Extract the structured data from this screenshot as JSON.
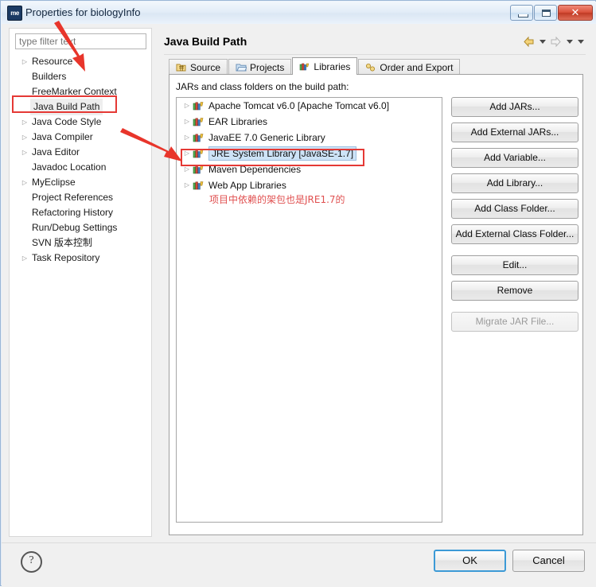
{
  "window": {
    "title": "Properties for biologyInfo",
    "icon": "myeclipse-icon",
    "icon_text": "me",
    "controls": {
      "minimize": "minimize-button",
      "maximize": "maximize-button",
      "close": "close-button",
      "close_glyph": "✕"
    }
  },
  "sidebar": {
    "filter_placeholder": "type filter text",
    "filter_value": "",
    "items": [
      {
        "label": "Resource",
        "expandable": true,
        "selected": false
      },
      {
        "label": "Builders",
        "expandable": false,
        "selected": false
      },
      {
        "label": "FreeMarker Context",
        "expandable": false,
        "selected": false
      },
      {
        "label": "Java Build Path",
        "expandable": false,
        "selected": true
      },
      {
        "label": "Java Code Style",
        "expandable": true,
        "selected": false
      },
      {
        "label": "Java Compiler",
        "expandable": true,
        "selected": false
      },
      {
        "label": "Java Editor",
        "expandable": true,
        "selected": false
      },
      {
        "label": "Javadoc Location",
        "expandable": false,
        "selected": false
      },
      {
        "label": "MyEclipse",
        "expandable": true,
        "selected": false
      },
      {
        "label": "Project References",
        "expandable": false,
        "selected": false
      },
      {
        "label": "Refactoring History",
        "expandable": false,
        "selected": false
      },
      {
        "label": "Run/Debug Settings",
        "expandable": false,
        "selected": false
      },
      {
        "label": "SVN 版本控制",
        "expandable": false,
        "selected": false
      },
      {
        "label": "Task Repository",
        "expandable": true,
        "selected": false
      }
    ]
  },
  "main": {
    "page_title": "Java Build Path",
    "nav": {
      "back": "back-arrow-icon",
      "back_dropdown": "back-dropdown-icon",
      "forward": "forward-arrow-icon",
      "forward_dropdown": "forward-dropdown-icon",
      "menu": "view-menu-icon"
    },
    "tabs": [
      {
        "label": "Source",
        "icon": "source-folder-icon",
        "active": false
      },
      {
        "label": "Projects",
        "icon": "projects-folder-icon",
        "active": false
      },
      {
        "label": "Libraries",
        "icon": "libraries-icon",
        "active": true
      },
      {
        "label": "Order and Export",
        "icon": "order-export-icon",
        "active": false
      }
    ],
    "list_label": "JARs and class folders on the build path:",
    "libraries": [
      {
        "label": "Apache Tomcat v6.0 [Apache Tomcat v6.0]",
        "selected": false
      },
      {
        "label": "EAR Libraries",
        "selected": false
      },
      {
        "label": "JavaEE 7.0 Generic Library",
        "selected": false
      },
      {
        "label": "JRE System Library [JavaSE-1.7]",
        "selected": true
      },
      {
        "label": "Maven Dependencies",
        "selected": false
      },
      {
        "label": "Web App Libraries",
        "selected": false
      }
    ],
    "buttons": [
      {
        "label": "Add JARs...",
        "disabled": false,
        "gap": false
      },
      {
        "label": "Add External JARs...",
        "disabled": false,
        "gap": false
      },
      {
        "label": "Add Variable...",
        "disabled": false,
        "gap": false
      },
      {
        "label": "Add Library...",
        "disabled": false,
        "gap": false
      },
      {
        "label": "Add Class Folder...",
        "disabled": false,
        "gap": false
      },
      {
        "label": "Add External Class Folder...",
        "disabled": false,
        "gap": false
      },
      {
        "label": "Edit...",
        "disabled": false,
        "gap": true
      },
      {
        "label": "Remove",
        "disabled": false,
        "gap": false
      },
      {
        "label": "Migrate JAR File...",
        "disabled": true,
        "gap": true
      }
    ]
  },
  "annotations": {
    "note_text": "项目中依赖的架包也是JRE1.7的",
    "color": "#e53935"
  },
  "footer": {
    "help": "?",
    "ok_label": "OK",
    "cancel_label": "Cancel"
  }
}
